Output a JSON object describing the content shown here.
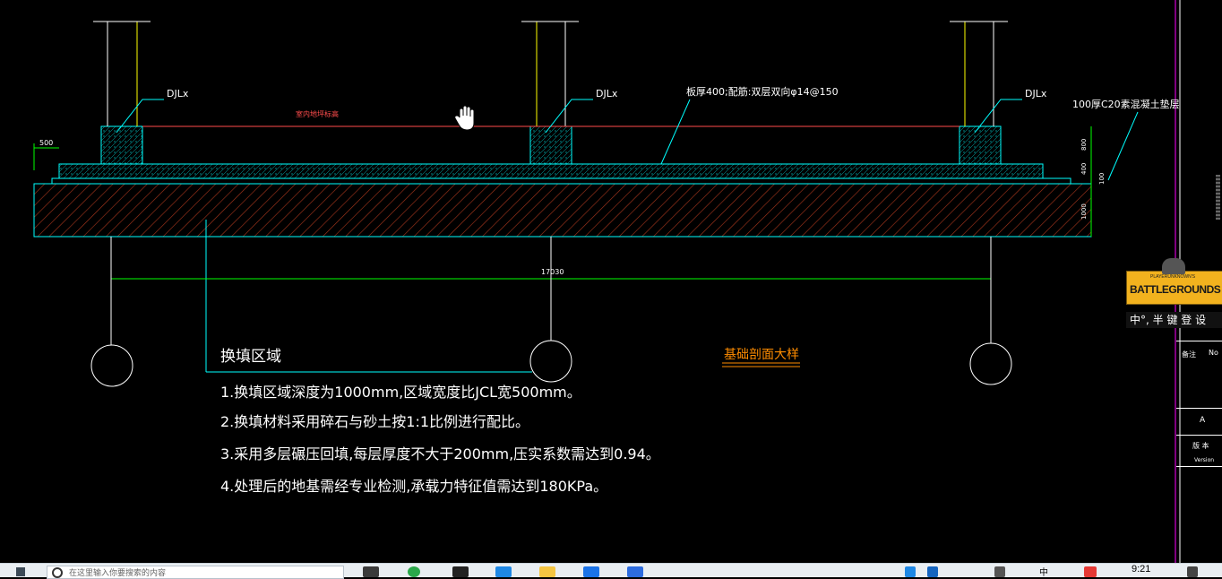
{
  "drawing": {
    "column_labels": [
      "DJLx",
      "DJLx",
      "DJLx"
    ],
    "indoor_level_label": "室内地坪标高",
    "slab_note": "板厚400;配筋:双层双向φ14@150",
    "cushion_note": "100厚C20素混凝土垫层",
    "dim_500": "500",
    "dim_800": "800",
    "dim_400": "400",
    "dim_100": "100",
    "dim_1000": "1000",
    "dim_total": "17030",
    "section_title": "基础剖面大样",
    "notes_title": "换填区域",
    "notes": [
      "1.换填区域深度为1000mm,区域宽度比JCL宽500mm。",
      "2.换填材料采用碎石与砂土按1:1比例进行配比。",
      "3.采用多层碾压回填,每层厚度不大于200mm,压实系数需达到0.94。",
      "4.处理后的地基需经专业检测,承载力特征值需达到180KPa。"
    ],
    "colors": {
      "concrete": "#00ffff",
      "hatch": "#ff6a3d",
      "fill_hatch": "#b0381e",
      "dim": "#00ff00",
      "column": "#ffff00",
      "level": "#ff4d4d",
      "title": "#ff8c00"
    }
  },
  "title_block": {
    "row1_label": "备注",
    "row1_value": "No",
    "axis_label": "A",
    "version_label": "版 本",
    "version_en": "Version"
  },
  "overlay": {
    "game_name": "BATTLEGROUNDS",
    "game_small": "PLAYERUNKNOWN'S",
    "ime_text": "中°, 半 键 登 设"
  },
  "taskbar": {
    "search_placeholder": "在这里输入你要搜索的内容",
    "time": "9:21",
    "ime": "中"
  }
}
